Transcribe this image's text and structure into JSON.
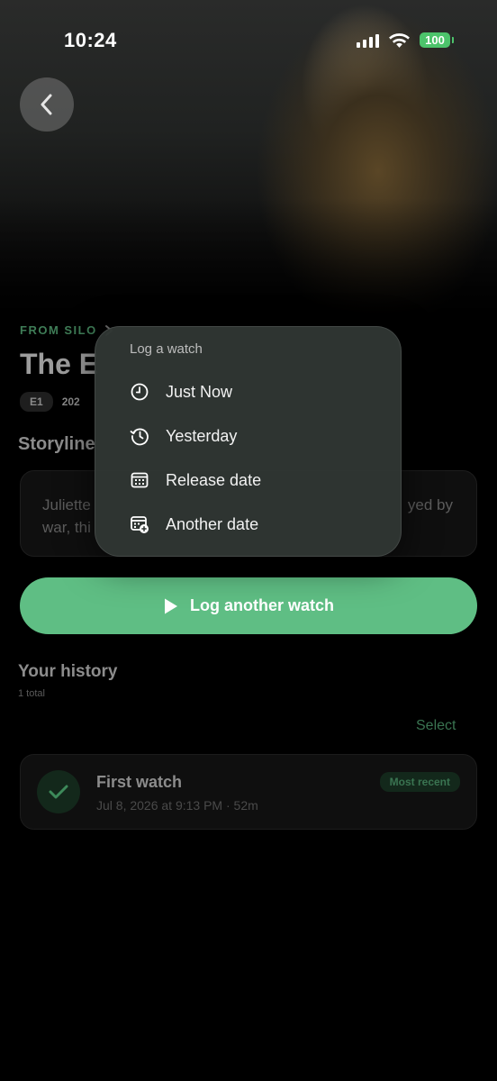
{
  "status": {
    "time": "10:24",
    "battery": "100"
  },
  "episode": {
    "from_label": "FROM SILO",
    "title": "The E",
    "chips": [
      "E1",
      "202"
    ],
    "storyline_heading": "Storyline",
    "story_line1_left": "Juliette",
    "story_line1_right": "yed by",
    "story_line2": "war, thi"
  },
  "log_button": {
    "label": "Log another watch"
  },
  "history": {
    "heading": "Your history",
    "count": "1 total",
    "select_label": "Select",
    "items": [
      {
        "title": "First watch",
        "date": "Jul 8, 2026 at 9:13 PM · 52m",
        "badge": "Most recent"
      }
    ]
  },
  "menu": {
    "title": "Log a watch",
    "items": [
      {
        "label": "Just Now",
        "icon": "clock-icon"
      },
      {
        "label": "Yesterday",
        "icon": "history-icon"
      },
      {
        "label": "Release date",
        "icon": "calendar-icon"
      },
      {
        "label": "Another date",
        "icon": "calendar-add-icon"
      }
    ]
  },
  "colors": {
    "accent": "#5fbe84",
    "background": "#000000",
    "menu_bg": "#303633"
  }
}
